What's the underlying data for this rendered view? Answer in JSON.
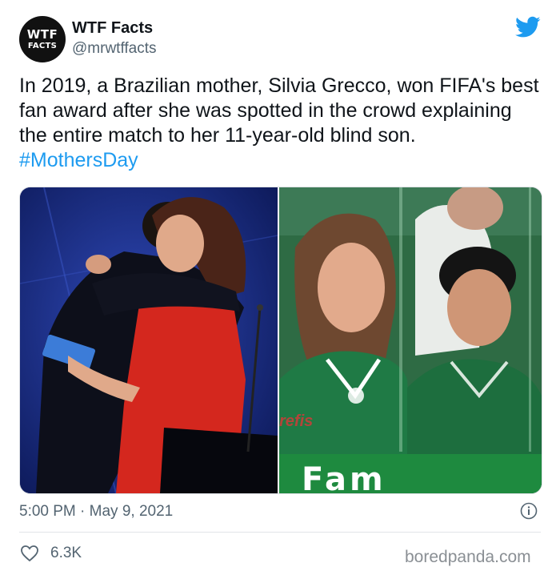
{
  "author": {
    "avatar_line1": "WTF",
    "avatar_line2": "FACTS",
    "display_name": "WTF Facts",
    "handle": "@mrwtffacts"
  },
  "tweet": {
    "text": "In 2019, a Brazilian mother, Silvia Grecco, won FIFA's best fan award after she was spotted in the crowd explaining the entire match to her 11-year-old blind son. ",
    "hashtag": "#MothersDay"
  },
  "media": {
    "left_scoreboard_text": "",
    "right_banner_text": "Fam",
    "right_sponsor_text": "refis"
  },
  "meta": {
    "timestamp": "5:00 PM · May 9, 2021",
    "likes": "6.3K"
  },
  "watermark": "boredpanda.com",
  "colors": {
    "twitter_blue": "#1d9bf0",
    "text": "#0f1419",
    "muted": "#536471"
  },
  "icons": [
    "twitter-bird-icon",
    "info-icon",
    "heart-icon"
  ]
}
